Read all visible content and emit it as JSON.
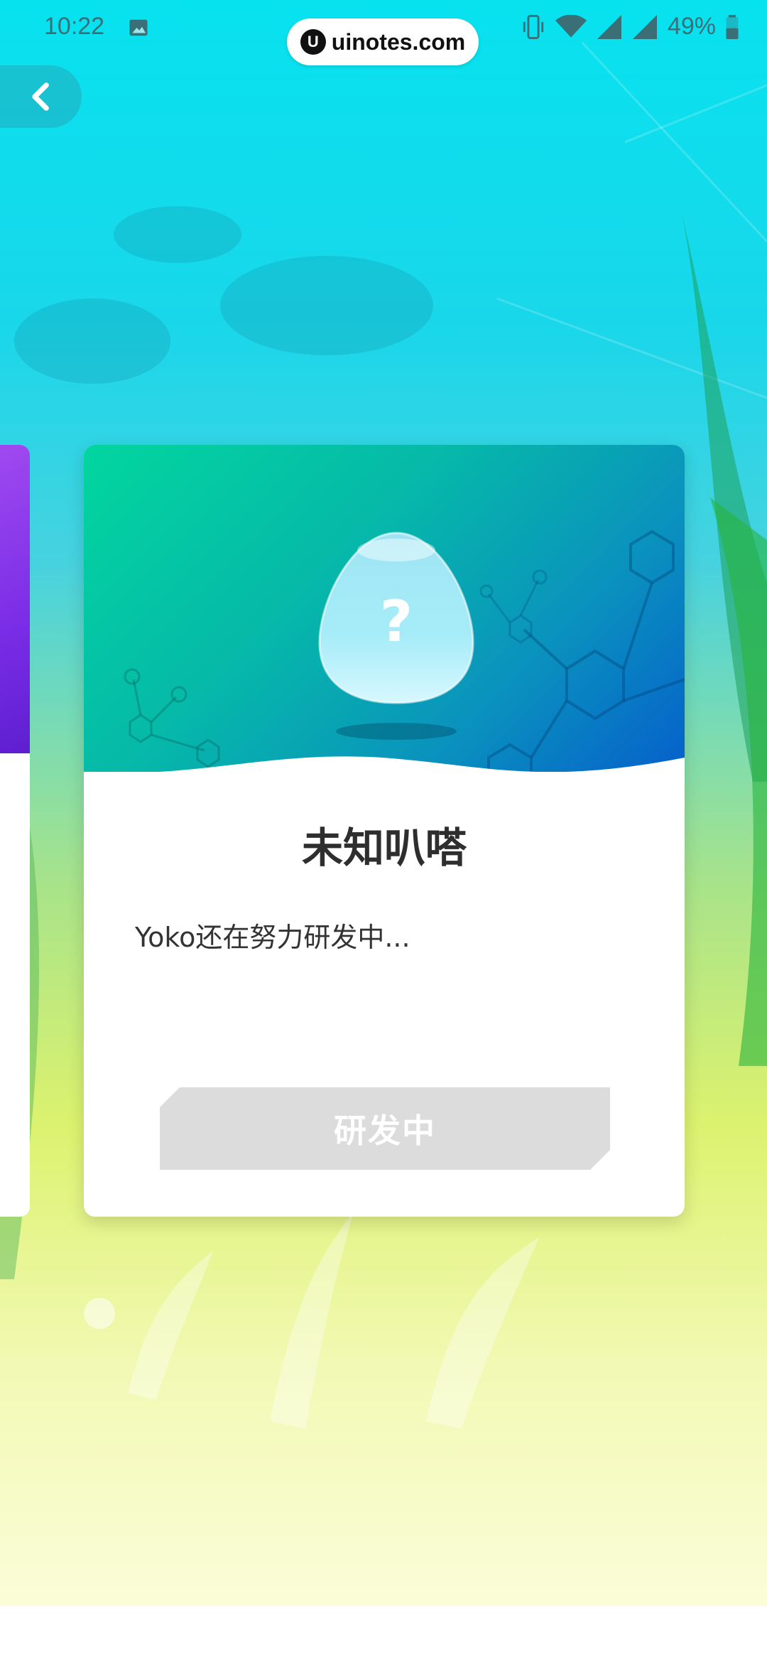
{
  "status_bar": {
    "time": "10:22",
    "battery_percent": "49%",
    "icons": [
      "gallery-icon",
      "vibrate-icon",
      "wifi-icon",
      "signal-icon",
      "signal-icon",
      "battery-icon"
    ]
  },
  "watermark": {
    "logo": "U",
    "text": "uinotes.com"
  },
  "nav": {
    "back_icon": "chevron-left-icon"
  },
  "card": {
    "title": "未知叭嗒",
    "description": "Yoko还在努力研发中...",
    "egg_symbol": "?",
    "button_label": "研发中"
  },
  "colors": {
    "sky_top": "#07e2ef",
    "card_header_start": "#02d69f",
    "card_header_end": "#0660cb",
    "side_card": "#7a2de6",
    "button_disabled": "#dcdcdc"
  }
}
